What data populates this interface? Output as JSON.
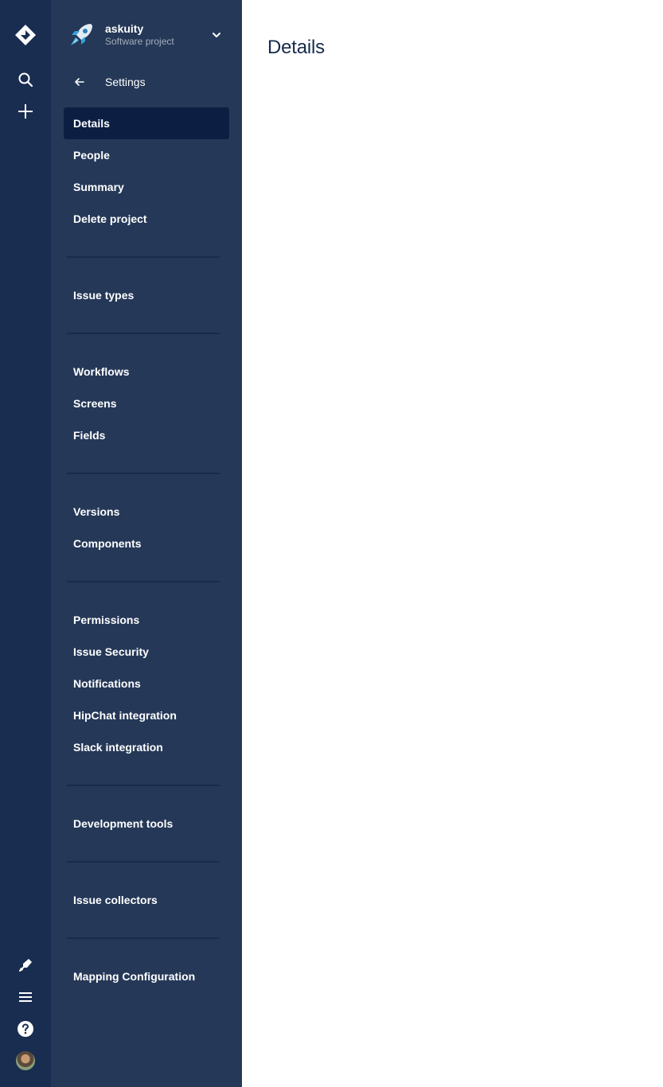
{
  "project": {
    "name": "askuity",
    "type": "Software project"
  },
  "settings": {
    "back_label": "Settings"
  },
  "nav_groups": [
    {
      "items": [
        {
          "label": "Details",
          "active": true
        },
        {
          "label": "People"
        },
        {
          "label": "Summary"
        },
        {
          "label": "Delete project"
        }
      ]
    },
    {
      "items": [
        {
          "label": "Issue types"
        }
      ]
    },
    {
      "items": [
        {
          "label": "Workflows"
        },
        {
          "label": "Screens"
        },
        {
          "label": "Fields"
        }
      ]
    },
    {
      "items": [
        {
          "label": "Versions"
        },
        {
          "label": "Components"
        }
      ]
    },
    {
      "items": [
        {
          "label": "Permissions"
        },
        {
          "label": "Issue Security"
        },
        {
          "label": "Notifications"
        },
        {
          "label": "HipChat integration"
        },
        {
          "label": "Slack integration"
        }
      ]
    },
    {
      "items": [
        {
          "label": "Development tools"
        }
      ]
    },
    {
      "items": [
        {
          "label": "Issue collectors"
        }
      ]
    },
    {
      "items": [
        {
          "label": "Mapping Configuration"
        }
      ]
    }
  ],
  "main": {
    "title": "Details"
  },
  "global_nav": {
    "icons": [
      "jira-logo-icon",
      "search-icon",
      "create-icon",
      "notification-icon",
      "menu-icon",
      "help-icon",
      "avatar"
    ]
  },
  "colors": {
    "global_nav_bg": "#192d50",
    "sidebar_bg": "#253858",
    "active_item_bg": "#0c1f43",
    "title_text": "#172b4d"
  }
}
